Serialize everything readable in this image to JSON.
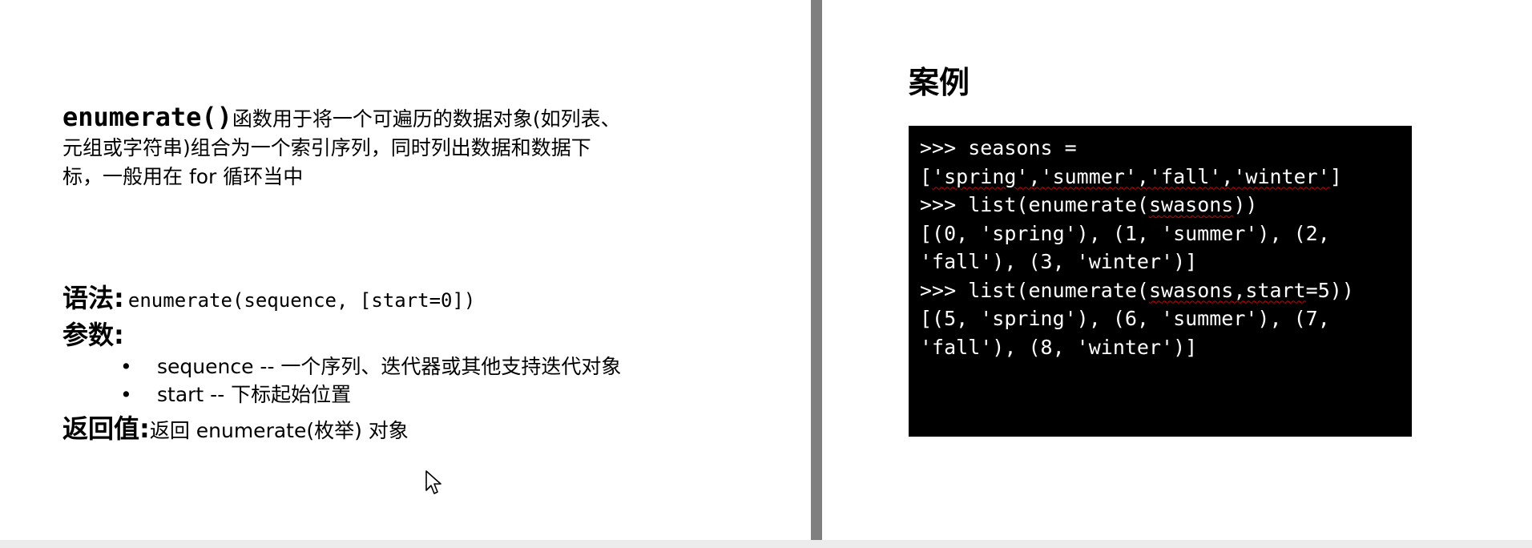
{
  "left_slide": {
    "intro": {
      "function_name": "enumerate()",
      "line1": "函数用于将一个可遍历的数据对象(如列表、",
      "line2": "元组或字符串)组合为一个索引序列，同时列出数据和数据下",
      "line3": "标，一般用在 for 循环当中"
    },
    "syntax": {
      "label": "语法:",
      "text": "enumerate(sequence, [start=0])"
    },
    "params": {
      "label": "参数:",
      "bullet": "•",
      "items": [
        "sequence -- 一个序列、迭代器或其他支持迭代对象",
        "start -- 下标起始位置"
      ]
    },
    "return_value": {
      "label": "返回值:",
      "text": "返回 enumerate(枚举) 对象"
    }
  },
  "right_slide": {
    "title": "案例",
    "terminal": {
      "l1": ">>> seasons =",
      "l2_open": "[",
      "l2_spell": "'spring','summer','fall','winter'",
      "l2_close": "]",
      "l3_pre": ">>> list(enumerate(",
      "l3_spell": "swasons",
      "l3_post": "))",
      "l4": "[(0, 'spring'), (1, 'summer'), (2,",
      "l5": "'fall'), (3, 'winter')]",
      "l6_pre": ">>> list(enumerate(",
      "l6_spell": "swasons,start",
      "l6_post": "=5))",
      "l7": "[(5, 'spring'), (6, 'summer'), (7,",
      "l8": "'fall'), (8, 'winter')]"
    }
  },
  "colors": {
    "divider": "#7f7f7f",
    "terminal_bg": "#000000",
    "terminal_text": "#ffffff",
    "spellcheck_underline": "#d10000"
  },
  "icons": {
    "cursor": "mouse-pointer-icon"
  }
}
